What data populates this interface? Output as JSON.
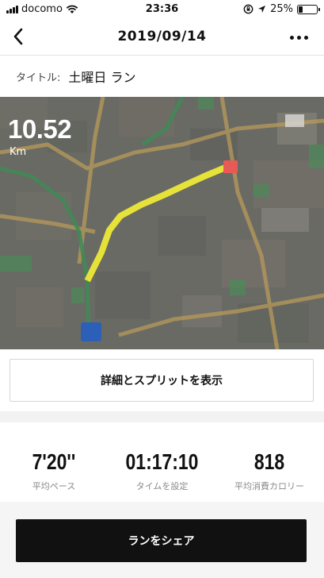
{
  "status_bar": {
    "carrier": "docomo",
    "time": "23:36",
    "battery": "25%",
    "battery_level": 0.25,
    "icons": [
      "signal-icon",
      "wifi-icon",
      "orientation-lock-icon",
      "location-icon",
      "battery-icon"
    ]
  },
  "nav": {
    "title": "2019/09/14",
    "back_icon": "chevron-left-icon",
    "more_icon": "more-icon"
  },
  "run": {
    "title_label": "タイトル:",
    "title_value": "土曜日 ラン"
  },
  "map": {
    "distance": "10.52",
    "distance_unit": "Km"
  },
  "details_button": {
    "label": "詳細とスプリットを表示"
  },
  "stats": [
    {
      "value": "7'20''",
      "label": "平均ペース"
    },
    {
      "value": "01:17:10",
      "label": "タイムを設定"
    },
    {
      "value": "818",
      "label": "平均消費カロリー"
    }
  ],
  "share_button": {
    "label": "ランをシェア"
  },
  "colors": {
    "route": "#e6e23a",
    "map_background": "#6a6a64",
    "map_road": "#b89a5a",
    "map_green": "#4d8a5a",
    "start_marker": "#2b5fb8",
    "end_marker": "#e85a55",
    "button_dark": "#111111"
  }
}
